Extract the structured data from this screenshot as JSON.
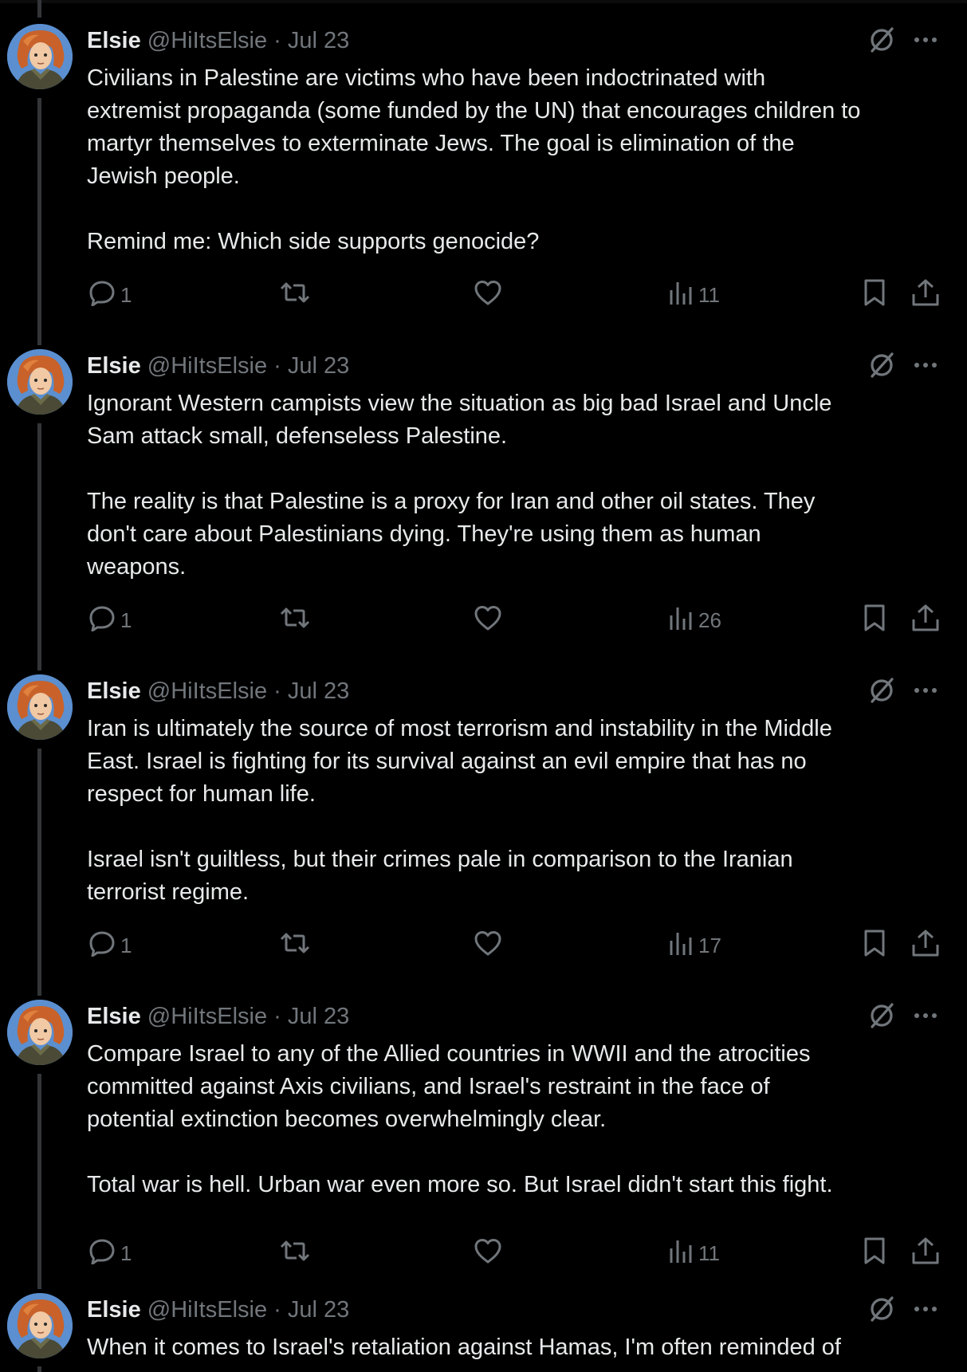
{
  "tweets": [
    {
      "name": "Elsie",
      "handle": "@HiItsElsie",
      "separator": "·",
      "date": "Jul 23",
      "text": "Civilians in Palestine are victims who have been indoctrinated with\nextremist propaganda (some funded by the UN) that encourages children to\nmartyr themselves to exterminate Jews. The goal is elimination of the\nJewish people.\n\nRemind me: Which side supports genocide?",
      "replies": "1",
      "views": "11"
    },
    {
      "name": "Elsie",
      "handle": "@HiItsElsie",
      "separator": "·",
      "date": "Jul 23",
      "text": "Ignorant Western campists view the situation as big bad Israel and Uncle\nSam attack small, defenseless Palestine.\n\nThe reality is that Palestine is a proxy for Iran and other oil states. They\ndon't care about Palestinians dying. They're using them as human\nweapons.",
      "replies": "1",
      "views": "26"
    },
    {
      "name": "Elsie",
      "handle": "@HiItsElsie",
      "separator": "·",
      "date": "Jul 23",
      "text": "Iran is ultimately the source of most terrorism and instability in the Middle\nEast. Israel is fighting for its survival against an evil empire that has no\nrespect for human life.\n\nIsrael isn't guiltless, but their crimes pale in comparison to the Iranian\nterrorist regime.",
      "replies": "1",
      "views": "17"
    },
    {
      "name": "Elsie",
      "handle": "@HiItsElsie",
      "separator": "·",
      "date": "Jul 23",
      "text": "Compare Israel to any of the Allied countries in WWII and the atrocities\ncommitted against Axis civilians, and Israel's restraint in the face of\npotential extinction becomes overwhelmingly clear.\n\nTotal war is hell. Urban war even more so. But Israel didn't start this fight.",
      "replies": "1",
      "views": "11"
    },
    {
      "name": "Elsie",
      "handle": "@HiItsElsie",
      "separator": "·",
      "date": "Jul 23",
      "text": "When it comes to Israel's retaliation against Hamas, I'm often reminded of"
    }
  ],
  "icons": {
    "reply": "reply-icon",
    "retweet": "retweet-icon",
    "like": "like-icon",
    "views": "views-icon",
    "bookmark": "bookmark-icon",
    "share": "share-icon",
    "grok": "grok-icon",
    "more": "more-icon"
  },
  "colors": {
    "background": "#000000",
    "text": "#e7e9ea",
    "muted": "#71767b",
    "thread_line": "#333639"
  }
}
